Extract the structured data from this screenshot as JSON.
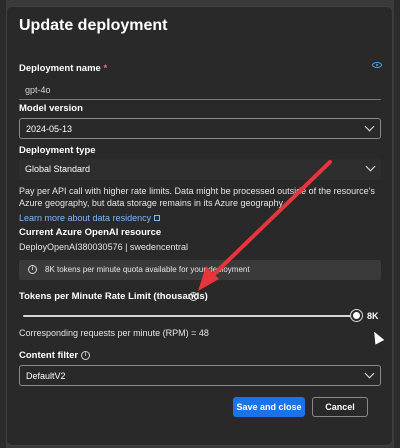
{
  "dialog": {
    "title": "Update deployment"
  },
  "deployment_name": {
    "label": "Deployment name",
    "required_mark": "*",
    "value": "gpt-4o"
  },
  "model_version": {
    "label": "Model version",
    "value": "2024-05-13"
  },
  "deployment_type": {
    "label": "Deployment type",
    "value": "Global Standard",
    "description": "Pay per API call with higher rate limits. Data might be processed outside of the resource's Azure geography, but data storage remains in its Azure geography.",
    "link": "Learn more about data residency"
  },
  "resource": {
    "label": "Current Azure OpenAI resource",
    "value": "DeployOpenAI380030576 | swedencentral"
  },
  "quota_info": {
    "text": "8K tokens per minute quota available for your deployment"
  },
  "rate_limit": {
    "label": "Tokens per Minute Rate Limit (thousands)",
    "value_label": "8K",
    "fraction": 1.0,
    "rpm_text": "Corresponding requests per minute (RPM) = 48"
  },
  "content_filter": {
    "label": "Content filter",
    "value": "DefaultV2"
  },
  "actions": {
    "save_label": "Save and close",
    "cancel_label": "Cancel"
  },
  "colors": {
    "primary_button": "#1a73e8",
    "annotation_arrow": "#e8353b",
    "link": "#7fb8ff"
  }
}
